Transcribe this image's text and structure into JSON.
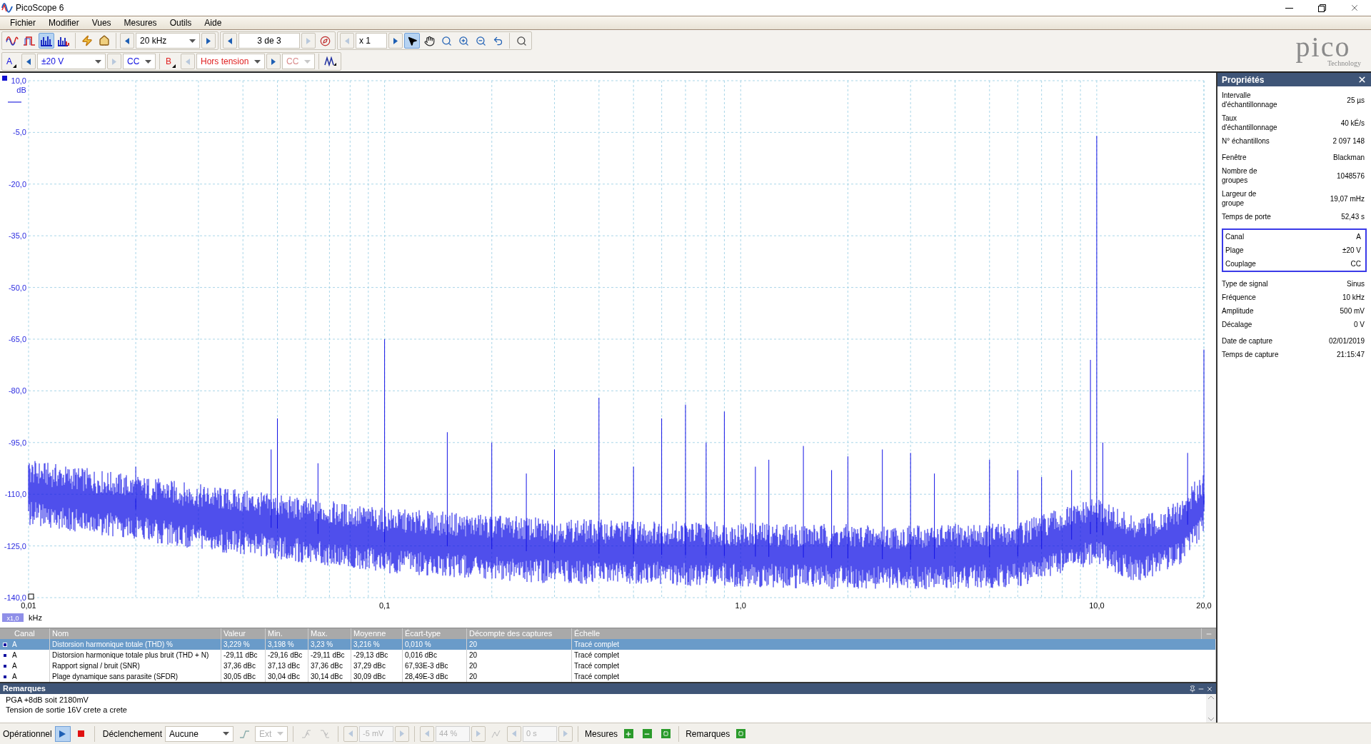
{
  "window": {
    "title": "PicoScope 6"
  },
  "menu": [
    "Fichier",
    "Modifier",
    "Vues",
    "Mesures",
    "Outils",
    "Aide"
  ],
  "modes": [
    {
      "kind": "scope",
      "selected": false
    },
    {
      "kind": "persistence",
      "selected": false
    },
    {
      "kind": "spectrum",
      "selected": true
    },
    {
      "kind": "spectrum_multi",
      "selected": false
    },
    {
      "kind": "wizard",
      "selected": false
    },
    {
      "kind": "home",
      "selected": false
    }
  ],
  "timebase": {
    "value": "20 kHz"
  },
  "capture": {
    "value": "3 de 3",
    "prev_disabled": false,
    "next_disabled": true
  },
  "zoom": {
    "value": "x 1",
    "prev_disabled": true,
    "next_disabled": false
  },
  "tools": [
    {
      "kind": "pointer",
      "selected": true
    },
    {
      "kind": "hand",
      "selected": false
    },
    {
      "kind": "zoom_box",
      "selected": false
    },
    {
      "kind": "zoom_in",
      "selected": false
    },
    {
      "kind": "zoom_out",
      "selected": false
    },
    {
      "kind": "undo",
      "selected": false
    },
    {
      "kind": "zoom_fit",
      "selected": false
    }
  ],
  "channels": [
    {
      "label": "A",
      "range": "±20 V",
      "coupling": "CC",
      "color": "#1010e0",
      "enabled": true,
      "prev_disabled": false,
      "next_disabled": true
    },
    {
      "label": "B",
      "range": "Hors tension",
      "coupling": "CC",
      "color": "#e02020",
      "enabled": false,
      "prev_disabled": true,
      "next_disabled": false
    }
  ],
  "logo": {
    "name": "pico",
    "tagline": "Technology"
  },
  "spectrum": {
    "y_ticks": [
      "10,0",
      "-5,0",
      "-20,0",
      "-35,0",
      "-50,0",
      "-65,0",
      "-80,0",
      "-95,0",
      "-110,0",
      "-125,0",
      "-140,0"
    ],
    "y_unit": "dB",
    "x_ticks": [
      "0,01",
      "0,1",
      "1,0",
      "10,0",
      "20,0"
    ],
    "x_unit": "kHz",
    "x_zoom": "x1,0"
  },
  "measurements": {
    "columns": [
      "Canal",
      "Nom",
      "Valeur",
      "Min.",
      "Max.",
      "Moyenne",
      "Écart-type",
      "Décompte des captures",
      "Échelle"
    ],
    "rows": [
      {
        "selected": true,
        "cells": [
          "A",
          "Distorsion harmonique totale (THD) %",
          "3,229 %",
          "3,198 %",
          "3,23 %",
          "3,216 %",
          "0,010 %",
          "20",
          "Tracé complet"
        ]
      },
      {
        "selected": false,
        "cells": [
          "A",
          "Distorsion harmonique totale plus bruit (THD + N)",
          "-29,11 dBc",
          "-29,16 dBc",
          "-29,11 dBc",
          "-29,13 dBc",
          "0,016 dBc",
          "20",
          "Tracé complet"
        ]
      },
      {
        "selected": false,
        "cells": [
          "A",
          "Rapport signal / bruit (SNR)",
          "37,36 dBc",
          "37,13 dBc",
          "37,36 dBc",
          "37,29 dBc",
          "67,93E-3 dBc",
          "20",
          "Tracé complet"
        ]
      },
      {
        "selected": false,
        "cells": [
          "A",
          "Plage dynamique sans parasite (SFDR)",
          "30,05 dBc",
          "30,04 dBc",
          "30,14 dBc",
          "30,09 dBc",
          "28,49E-3 dBc",
          "20",
          "Tracé complet"
        ]
      }
    ]
  },
  "notes": {
    "title": "Remarques",
    "lines": [
      "PGA +8dB soit 2180mV",
      "Tension de sortie 16V crete a crete"
    ]
  },
  "properties": {
    "title": "Propriétés",
    "groups": [
      {
        "boxed": false,
        "items": [
          {
            "label": "Intervalle\nd'échantillonnage",
            "value": "25 µs"
          },
          {
            "label": "Taux\nd'échantillonnage",
            "value": "40 kÉ/s"
          },
          {
            "label": "N° échantillons",
            "value": "2 097 148"
          }
        ]
      },
      {
        "boxed": false,
        "items": [
          {
            "label": "Fenêtre",
            "value": "Blackman"
          },
          {
            "label": "Nombre de\ngroupes",
            "value": "1048576"
          },
          {
            "label": "Largeur de\ngroupe",
            "value": "19,07 mHz"
          },
          {
            "label": "Temps de porte",
            "value": "52,43 s"
          }
        ]
      },
      {
        "boxed": true,
        "items": [
          {
            "label": "Canal",
            "value": "A"
          },
          {
            "label": "Plage",
            "value": "±20 V"
          },
          {
            "label": "Couplage",
            "value": "CC"
          }
        ]
      },
      {
        "boxed": false,
        "items": [
          {
            "label": "Type de signal",
            "value": "Sinus"
          },
          {
            "label": "Fréquence",
            "value": "10 kHz"
          },
          {
            "label": "Amplitude",
            "value": "500 mV"
          },
          {
            "label": "Décalage",
            "value": "0 V"
          }
        ]
      },
      {
        "boxed": false,
        "items": [
          {
            "label": "Date de capture",
            "value": "02/01/2019"
          },
          {
            "label": "Temps de capture",
            "value": "21:15:47"
          }
        ]
      }
    ]
  },
  "status": {
    "state": "Opérationnel",
    "running": true,
    "trigger_label": "Déclenchement",
    "trigger_mode": "Aucune",
    "source": "Ext",
    "threshold": "-5 mV",
    "pretrigger": "44 %",
    "delay": "0 s",
    "controls_disabled": true,
    "measures_label": "Mesures",
    "notes_label": "Remarques"
  }
}
